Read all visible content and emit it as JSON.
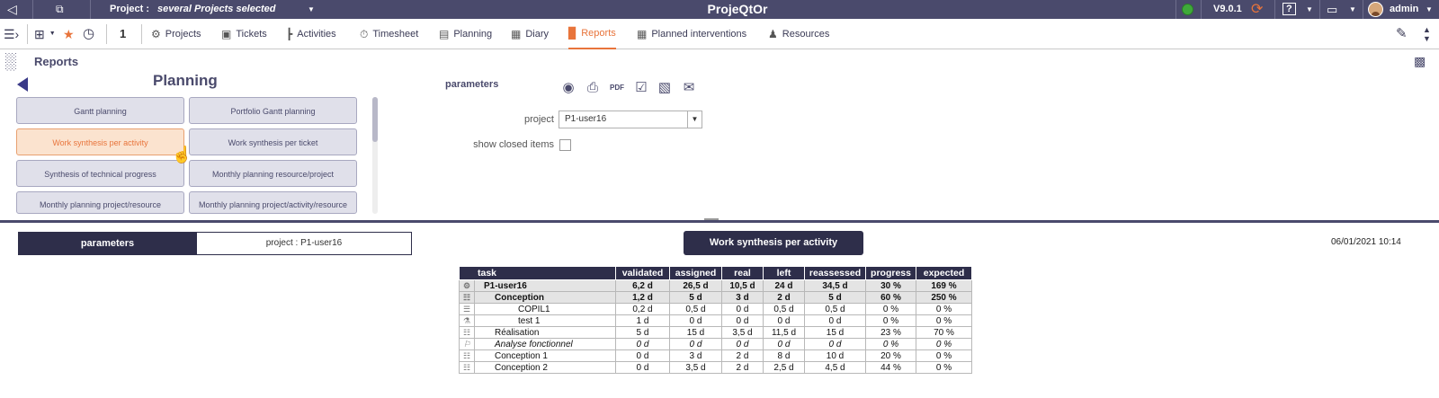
{
  "topbar": {
    "project_label": "Project :",
    "project_value": "several Projects selected",
    "app_title": "ProjeQtOr",
    "version": "V9.0.1",
    "help": "?",
    "user": "admin"
  },
  "menubar": {
    "selected_count": "1",
    "items": [
      {
        "label": "Projects",
        "icon": "gear-icon"
      },
      {
        "label": "Tickets",
        "icon": "ticket-icon"
      },
      {
        "label": "Activities",
        "icon": "activities-icon"
      },
      {
        "label": "Timesheet",
        "icon": "stopwatch-icon"
      },
      {
        "label": "Planning",
        "icon": "planning-icon"
      },
      {
        "label": "Diary",
        "icon": "calendar-icon"
      },
      {
        "label": "Reports",
        "icon": "chart-icon"
      },
      {
        "label": "Planned interventions",
        "icon": "grid-icon"
      },
      {
        "label": "Resources",
        "icon": "person-icon"
      }
    ]
  },
  "reports": {
    "header": "Reports",
    "category": "Planning",
    "buttons": [
      "Gantt planning",
      "Portfolio Gantt planning",
      "Work synthesis per activity",
      "Work synthesis per ticket",
      "Synthesis of technical progress",
      "Monthly planning resource/project",
      "Monthly planning project/resource",
      "Monthly planning project/activity/resource"
    ],
    "active": "Work synthesis per activity"
  },
  "parameters": {
    "title": "parameters",
    "project_label": "project",
    "project_value": "P1-user16",
    "closed_label": "show closed items"
  },
  "result": {
    "param_label": "parameters",
    "param_value": "project : P1-user16",
    "title": "Work synthesis per activity",
    "date": "06/01/2021 10:14",
    "columns": [
      "task",
      "validated",
      "assigned",
      "real",
      "left",
      "reassessed",
      "progress",
      "expected"
    ],
    "rows": [
      {
        "task": "P1-user16",
        "level": 0,
        "icon": "project-icon",
        "validated": "6,2 d",
        "assigned": "26,5 d",
        "real": "10,5 d",
        "left": "24 d",
        "reassessed": "34,5 d",
        "progress": "30 %",
        "expected": "169 %"
      },
      {
        "task": "Conception",
        "level": 1,
        "icon": "activity-icon",
        "validated": "1,2 d",
        "assigned": "5 d",
        "real": "3 d",
        "left": "2 d",
        "reassessed": "5 d",
        "progress": "60 %",
        "expected": "250 %"
      },
      {
        "task": "COPIL1",
        "level": 2,
        "icon": "meeting-icon",
        "validated": "0,2 d",
        "assigned": "0,5 d",
        "real": "0 d",
        "left": "0,5 d",
        "reassessed": "0,5 d",
        "progress": "0 %",
        "expected": "0 %"
      },
      {
        "task": "test 1",
        "level": 2,
        "icon": "test-icon",
        "validated": "1 d",
        "assigned": "0 d",
        "real": "0 d",
        "left": "0 d",
        "reassessed": "0 d",
        "progress": "0 %",
        "expected": "0 %"
      },
      {
        "task": "Réalisation",
        "level": 1,
        "icon": "activity-icon",
        "validated": "5 d",
        "assigned": "15 d",
        "real": "3,5 d",
        "left": "11,5 d",
        "reassessed": "15 d",
        "progress": "23 %",
        "expected": "70 %"
      },
      {
        "task": "Analyse fonctionnel",
        "level": 1,
        "icon": "milestone-icon",
        "italic": true,
        "validated": "0 d",
        "assigned": "0 d",
        "real": "0 d",
        "left": "0 d",
        "reassessed": "0 d",
        "progress": "0 %",
        "expected": "0 %"
      },
      {
        "task": "Conception 1",
        "level": 1,
        "icon": "activity-icon",
        "validated": "0 d",
        "assigned": "3 d",
        "real": "2 d",
        "left": "8 d",
        "reassessed": "10 d",
        "progress": "20 %",
        "expected": "0 %"
      },
      {
        "task": "Conception 2",
        "level": 1,
        "icon": "activity-icon",
        "validated": "0 d",
        "assigned": "3,5 d",
        "real": "2 d",
        "left": "2,5 d",
        "reassessed": "4,5 d",
        "progress": "44 %",
        "expected": "0 %"
      }
    ]
  },
  "colors": {
    "header_bg": "#4a4a6c",
    "accent": "#e8743b",
    "table_header": "#2e2e4a"
  }
}
